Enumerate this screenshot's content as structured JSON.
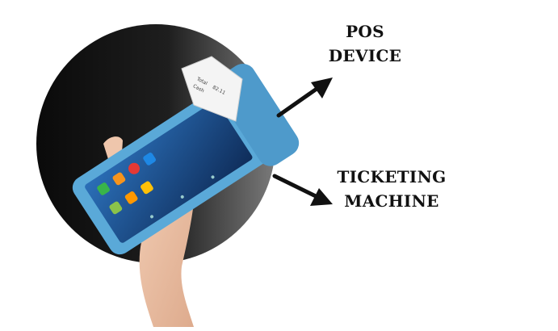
{
  "labels": {
    "pos": [
      "POS",
      "DEVICE"
    ],
    "ticketing": [
      "TICKETING",
      "MACHINE"
    ]
  },
  "receipt": {
    "lines": [
      "Total",
      "Cash",
      "82.11"
    ]
  },
  "icons": [
    "phone-app-icon",
    "message-app-icon",
    "chrome-app-icon",
    "settings-app-icon",
    "gallery-app-icon",
    "camera-app-icon",
    "music-app-icon"
  ],
  "colors": {
    "device_blue": "#5aa9d8",
    "screen": "#163a6e",
    "circle_dark": "#111111",
    "arrow": "#111111"
  }
}
